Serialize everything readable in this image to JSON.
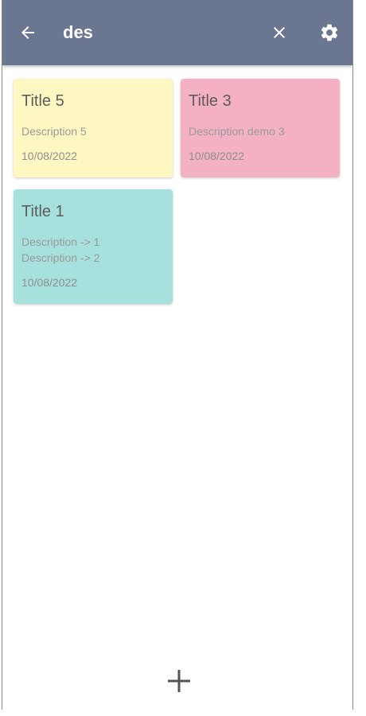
{
  "toolbar": {
    "search_value": "des",
    "background_color": "#6b7690"
  },
  "icons": {
    "back": "arrow-back-icon",
    "clear": "close-icon",
    "settings": "gear-icon",
    "add": "plus-icon"
  },
  "notes": [
    {
      "title": "Title 5",
      "description": "Description 5",
      "date": "10/08/2022",
      "color": "#fff7c2"
    },
    {
      "title": "Title 3",
      "description": "Description demo 3",
      "date": "10/08/2022",
      "color": "#f4b1c4"
    },
    {
      "title": "Title 1",
      "description": "Description -> 1\nDescription -> 2",
      "date": "10/08/2022",
      "color": "#a6e1dd"
    }
  ]
}
